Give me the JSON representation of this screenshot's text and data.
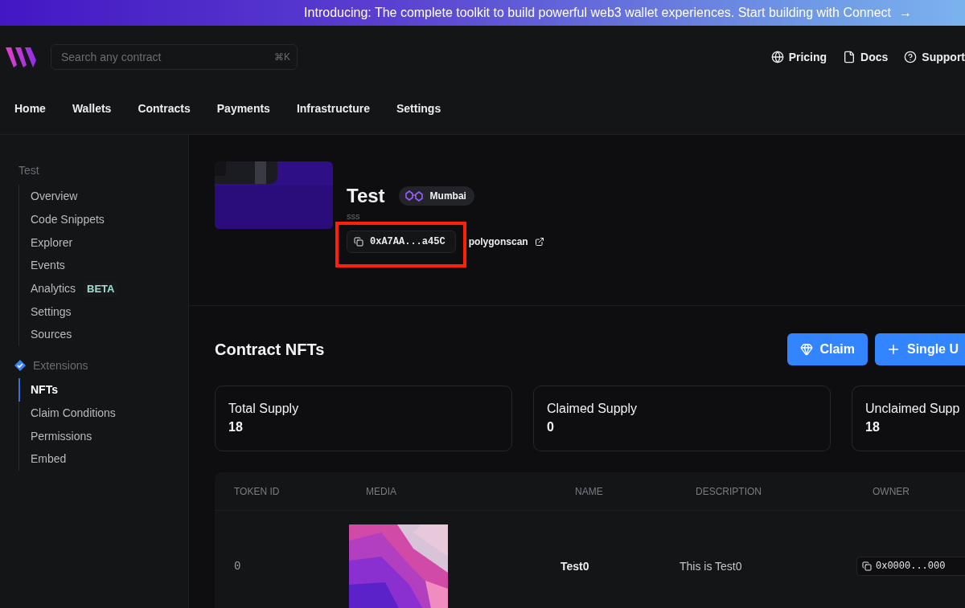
{
  "banner": {
    "text": "Introducing: The complete toolkit to build powerful web3 wallet experiences. Start building with Connect",
    "arrow": "→"
  },
  "header": {
    "search": {
      "placeholder": "Search any contract",
      "shortcut": "⌘K"
    },
    "links": [
      {
        "label": "Pricing",
        "kind": "globe"
      },
      {
        "label": "Docs",
        "kind": "file"
      },
      {
        "label": "Support",
        "kind": "help"
      }
    ]
  },
  "nav": [
    "Home",
    "Wallets",
    "Contracts",
    "Payments",
    "Infrastructure",
    "Settings"
  ],
  "sidebar": {
    "title": "Test",
    "items": [
      {
        "label": "Overview",
        "selected": false
      },
      {
        "label": "Code Snippets",
        "selected": false
      },
      {
        "label": "Explorer",
        "selected": false
      },
      {
        "label": "Events",
        "selected": false
      },
      {
        "label": "Analytics",
        "selected": false,
        "badge": "BETA"
      },
      {
        "label": "Settings",
        "selected": false
      },
      {
        "label": "Sources",
        "selected": false
      }
    ],
    "extensions": {
      "label": "Extensions",
      "items": [
        {
          "label": "NFTs",
          "selected": true
        },
        {
          "label": "Claim Conditions",
          "selected": false
        },
        {
          "label": "Permissions",
          "selected": false
        },
        {
          "label": "Embed",
          "selected": false
        }
      ]
    }
  },
  "contract": {
    "name": "Test",
    "network": "Mumbai",
    "description": "sss",
    "address": "0xA7AA...a45C",
    "highlighted": true,
    "explorer": "polygonscan"
  },
  "section": {
    "title": "Contract NFTs",
    "buttons": [
      {
        "label": "Claim",
        "kind": "claim"
      },
      {
        "label": "Single U",
        "kind": "add"
      }
    ]
  },
  "stats": [
    {
      "label": "Total Supply",
      "value": "18"
    },
    {
      "label": "Claimed Supply",
      "value": "0"
    },
    {
      "label": "Unclaimed Supp",
      "value": "18"
    }
  ],
  "table": {
    "columns": [
      "TOKEN ID",
      "MEDIA",
      "NAME",
      "DESCRIPTION",
      "OWNER"
    ],
    "rows": [
      {
        "token_id": "0",
        "name": "Test0",
        "description": "This is Test0",
        "owner": "0x0000...000"
      }
    ]
  }
}
